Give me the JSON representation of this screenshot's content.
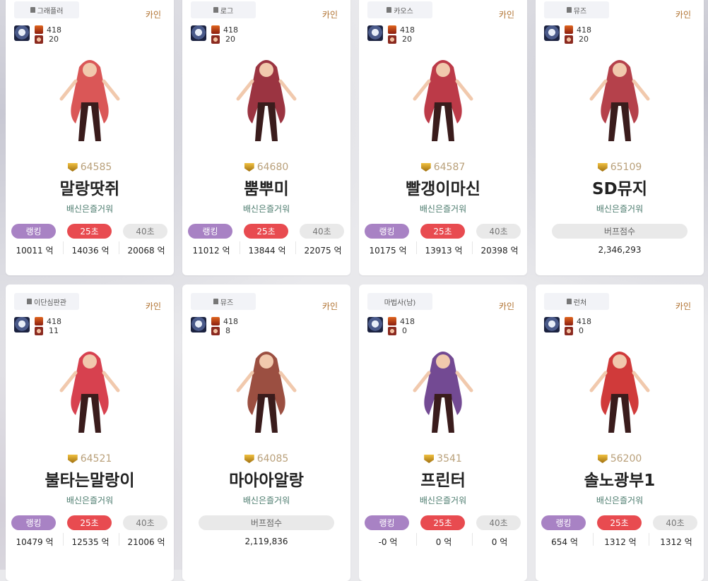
{
  "cards": [
    {
      "job": "그래플러",
      "server": "카인",
      "level": "418",
      "count": "20",
      "fame": "64585",
      "name": "말랑땃쥐",
      "guild": "배신은즐거워",
      "type": "damage",
      "rank_label": "랭킹",
      "t25_label": "25초",
      "t40_label": "40초",
      "v_rank": "10011 억",
      "v_25": "14036 억",
      "v_40": "20068 억",
      "color": "#d33a3a"
    },
    {
      "job": "로그",
      "server": "카인",
      "level": "418",
      "count": "20",
      "fame": "64680",
      "name": "뿜뿌미",
      "guild": "배신은즐거워",
      "type": "damage",
      "rank_label": "랭킹",
      "t25_label": "25초",
      "t40_label": "40초",
      "v_rank": "11012 억",
      "v_25": "13844 억",
      "v_40": "22075 억",
      "color": "#8a1020"
    },
    {
      "job": "카오스",
      "server": "카인",
      "level": "418",
      "count": "20",
      "fame": "64587",
      "name": "빨갱이마신",
      "guild": "배신은즐거워",
      "type": "damage",
      "rank_label": "랭킹",
      "t25_label": "25초",
      "t40_label": "40초",
      "v_rank": "10175 억",
      "v_25": "13913 억",
      "v_40": "20398 억",
      "color": "#b01828"
    },
    {
      "job": "뮤즈",
      "server": "카인",
      "level": "418",
      "count": "20",
      "fame": "65109",
      "name": "SD뮤지",
      "guild": "배신은즐거워",
      "type": "buff",
      "buff_label": "버프점수",
      "buff_value": "2,346,293",
      "color": "#a8202c"
    },
    {
      "job": "이단심판관",
      "server": "카인",
      "level": "418",
      "count": "11",
      "fame": "64521",
      "name": "불타는말랑이",
      "guild": "배신은즐거워",
      "type": "damage",
      "rank_label": "랭킹",
      "t25_label": "25초",
      "t40_label": "40초",
      "v_rank": "10479 억",
      "v_25": "12535 억",
      "v_40": "21006 억",
      "color": "#d02030"
    },
    {
      "job": "뮤즈",
      "server": "카인",
      "level": "418",
      "count": "8",
      "fame": "64085",
      "name": "마아아알랑",
      "guild": "배신은즐거워",
      "type": "buff",
      "buff_label": "버프점수",
      "buff_value": "2,119,836",
      "color": "#8a3020"
    },
    {
      "job": "마법사(남)",
      "server": "카인",
      "level": "418",
      "count": "0",
      "fame": "3541",
      "name": "프린터",
      "guild": "배신은즐거워",
      "type": "damage",
      "rank_label": "랭킹",
      "t25_label": "25초",
      "t40_label": "40초",
      "v_rank": "-0 억",
      "v_25": "0 억",
      "v_40": "0 억",
      "color": "#5a2a80"
    },
    {
      "job": "런처",
      "server": "카인",
      "level": "418",
      "count": "0",
      "fame": "56200",
      "name": "솔노광부1",
      "guild": "배신은즐거워",
      "type": "damage",
      "rank_label": "랭킹",
      "t25_label": "25초",
      "t40_label": "40초",
      "v_rank": "654 억",
      "v_25": "1312 억",
      "v_40": "1312 억",
      "color": "#c81818"
    }
  ]
}
